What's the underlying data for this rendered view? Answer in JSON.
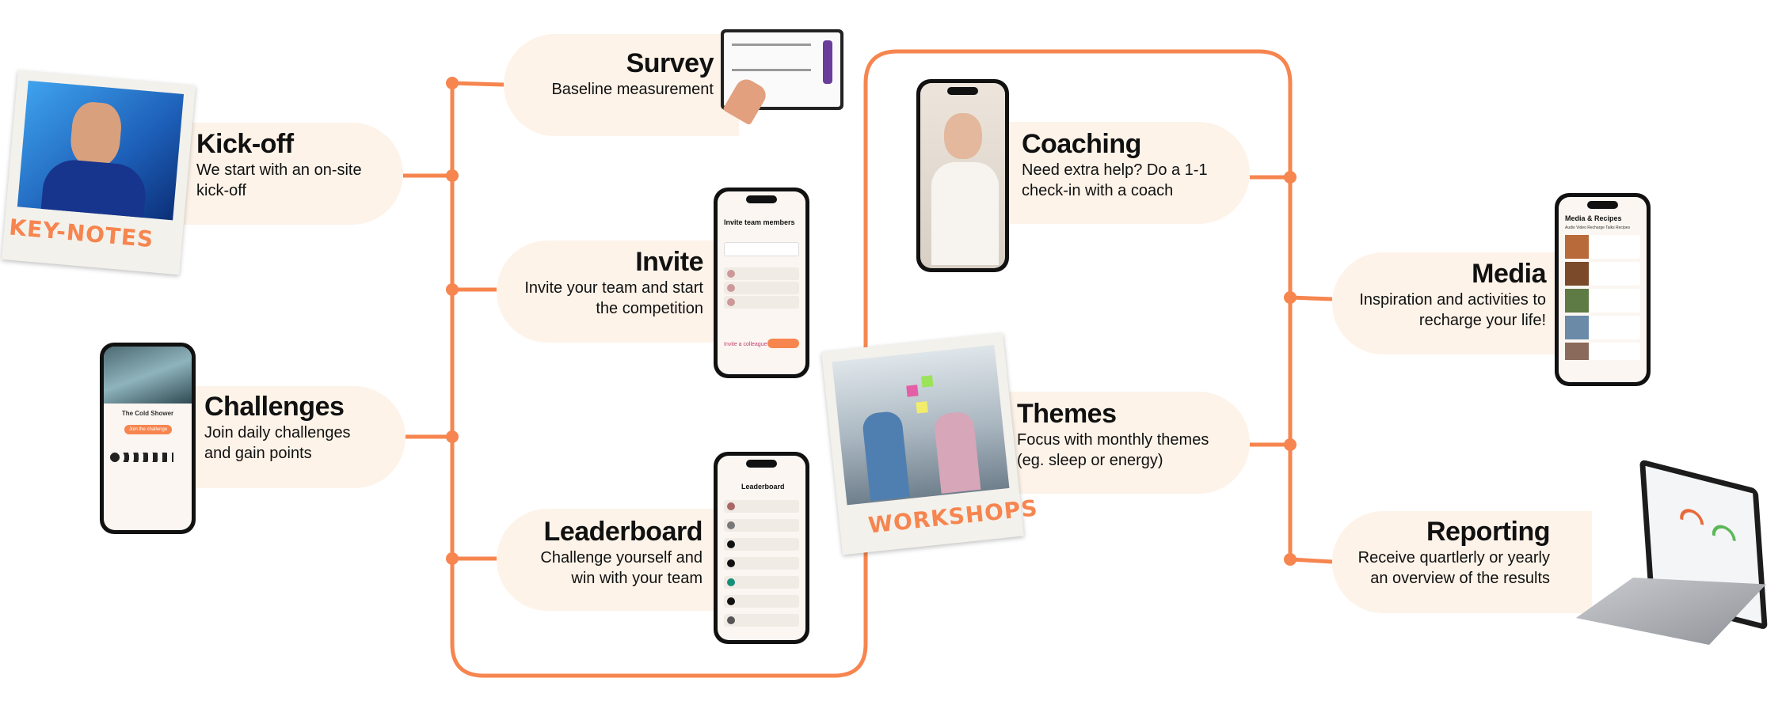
{
  "colors": {
    "accent": "#f6854f",
    "bubble": "#fdf3e9"
  },
  "steps": {
    "kickoff": {
      "title": "Kick-off",
      "desc": "We start with an on-site kick-off"
    },
    "survey": {
      "title": "Survey",
      "desc": "Baseline measurement"
    },
    "invite": {
      "title": "Invite",
      "desc": "Invite your team and start the competition"
    },
    "challenges": {
      "title": "Challenges",
      "desc": "Join daily challenges and gain points"
    },
    "leaderboard": {
      "title": "Leaderboard",
      "desc": "Challenge yourself and win with your team"
    },
    "coaching": {
      "title": "Coaching",
      "desc": "Need extra help? Do a 1-1 check-in with a coach"
    },
    "media": {
      "title": "Media",
      "desc": "Inspiration and activities to recharge your life!"
    },
    "themes": {
      "title": "Themes",
      "desc": "Focus with monthly themes (eg. sleep or energy)"
    },
    "reporting": {
      "title": "Reporting",
      "desc": "Receive quartlerly or yearly an overview of the results"
    }
  },
  "photos": {
    "keynotes_label": "KEY-NOTES",
    "workshops_label": "WORKSHOPS"
  },
  "screens": {
    "invite_title": "Invite team members",
    "invite_colleague": "Invite a colleague",
    "leaderboard_title": "Leaderboard",
    "challenge_title": "The Cold Shower",
    "challenge_button": "Join the challenge",
    "media_title": "Media & Recipes",
    "media_tabs": "Audio  Video  Recharge Talks  Recipes"
  }
}
